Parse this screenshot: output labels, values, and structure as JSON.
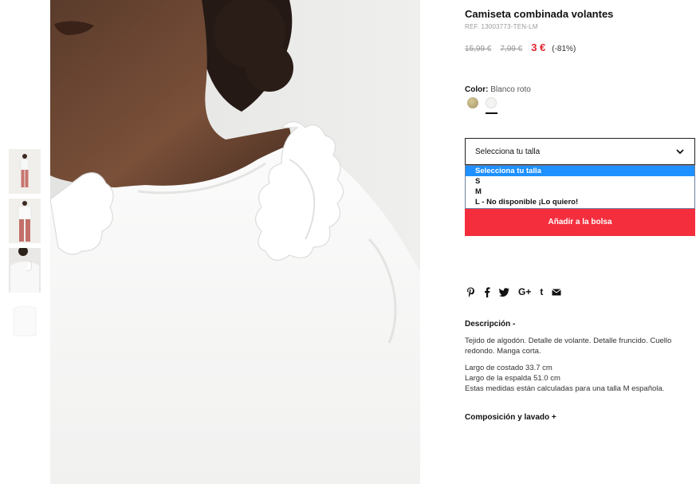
{
  "product": {
    "title": "Camiseta combinada volantes",
    "ref": "REF. 13003773-TEN-LM",
    "prices": {
      "original": "15,99 €",
      "previous": "7,99 €",
      "current": "3 €",
      "discount": "(-81%)"
    }
  },
  "color": {
    "label": "Color:",
    "value": "Blanco roto",
    "swatches": [
      {
        "name": "gold",
        "hex": "#bfae7c"
      },
      {
        "name": "white",
        "hex": "#f4f4f2"
      }
    ]
  },
  "size_select": {
    "value": "Selecciona tu talla",
    "options": [
      "Selecciona tu talla",
      "S",
      "M",
      "L - No disponible ¡Lo quiero!"
    ]
  },
  "add_to_bag": "Añadir a la bolsa",
  "share": {
    "pinterest": "P",
    "facebook": "f",
    "twitter": "t",
    "googleplus": "G+",
    "tumblr": "t"
  },
  "description": {
    "heading": "Descripción  -",
    "paragraph1": "Tejido de algodón. Detalle de volante. Detalle fruncido. Cuello redondo. Manga corta.",
    "measure1": "Largo de costado 33.7 cm",
    "measure2": "Largo de la espalda 51.0 cm",
    "measure3": "Estas medidas están calculadas para una talla M española."
  },
  "composition_heading": "Composición y lavado  +",
  "colors": {
    "accent": "#f42e3d",
    "price_red": "#e3232e",
    "select_highlight": "#1e90ff"
  }
}
